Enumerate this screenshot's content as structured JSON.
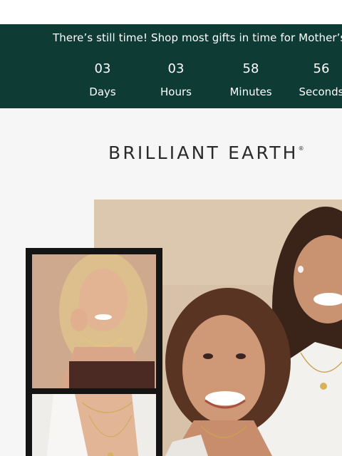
{
  "promo_banner": {
    "message": "There’s still time! Shop most gifts in time for Mother’s Day!",
    "countdown": [
      {
        "value": "03",
        "unit": "Days"
      },
      {
        "value": "03",
        "unit": "Hours"
      },
      {
        "value": "58",
        "unit": "Minutes"
      },
      {
        "value": "56",
        "unit": "Seconds"
      }
    ]
  },
  "brand": {
    "name": "BRILLIANT EARTH",
    "registered_mark": "®"
  },
  "colors": {
    "banner_bg": "#0f3b35",
    "page_bg": "#f6f6f6",
    "strip_frame": "#141414"
  }
}
